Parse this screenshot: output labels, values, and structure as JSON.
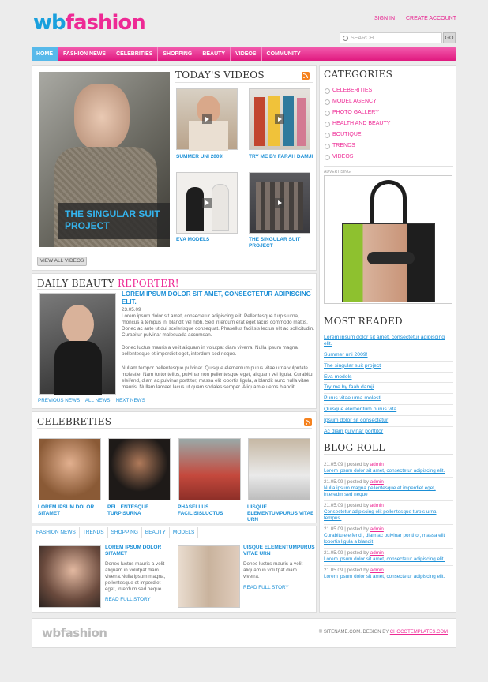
{
  "header": {
    "logo_part1": "wb",
    "logo_part2": "fashion",
    "sign_in": "SIGN IN",
    "create_account": "CREATE ACCOUNT",
    "search_placeholder": "SEARCH",
    "search_button": "GO"
  },
  "nav": [
    "HOME",
    "FASHION NEWS",
    "CELEBRITIES",
    "SHOPPING",
    "BEAUTY",
    "VIDEOS",
    "COMMUNITY"
  ],
  "feature": {
    "title": "THE SINGULAR SUIT PROJECT"
  },
  "videos": {
    "title": "TODAY'S VIDEOS",
    "items": [
      "SUMMER UNI 2009!",
      "TRY ME BY FARAH DAMJI",
      "EVA MODELS",
      "THE SINGULAR SUIT PROJECT"
    ],
    "view_all": "VIEW ALL VIDEOS"
  },
  "beauty": {
    "title_a": "DAILY BEAUTY ",
    "title_b": "REPORTER!",
    "headline": "LOREM IPSUM DOLOR SIT AMET, CONSECTETUR ADIPISCING ELIT.",
    "date": "23.05.09",
    "p1": "Lorem ipsum dolor sit amet, consectetur adipiscing elit. Pellentesque turpis urna, rhoncus a tempus in, blandit vel nibh. Sed interdum erat eget lacus commodo mattis. Donec ac ante ut dui scelerisque consequat. Phasellus facilisis lectus elit ac sollicitudin. Curabitur pulvinar malesuada accumsan.",
    "p2": "Donec luctus mauris a velit aliquam in volutpat diam viverra. Nulla ipsum magna, pellentesque et imperdiet eget, interdum sed neque.",
    "p3": "Nullam tempor pellentesque pulvinar. Quisque elementum purus vitae urna vulputate molestie. Nam tortor tellus, pulvinar non pellentesque eget, aliquam vel ligula. Curabitur eleifend, diam ac pulvinar porttitor, massa elit lobortis ligula, a blandit nunc nulla vitae mauris. Nullam laoreet lacus ut quam sodales semper. Aliquam eu eros blandit",
    "prev": "PREVIOUS NEWS",
    "all": "ALL NEWS",
    "next": "NEXT NEWS"
  },
  "celebs": {
    "title": "CELEBRETIES",
    "items": [
      "LOREM IPSUM DOLOR SITAMET",
      "PELLENTESQUE TURPISURNA",
      "PHASELLUS FACILISISLUCTUS",
      "UISQUE ELEMENTUMPURUS VITAE URN"
    ]
  },
  "tabs": [
    "FASHION NEWS",
    "TRENDS",
    "SHOPPING",
    "BEAUTY",
    "MODELS"
  ],
  "news": [
    {
      "title": "LOREM IPSUM DOLOR SITAMET",
      "body": "Donec luctus mauris a velit aliquam in volutpat diam viverra.Nulla ipsum magna, pellentesque et imperdiet eget, interdum sed neque.",
      "more": "READ FULL STORY"
    },
    {
      "title": "UISQUE ELEMENTUMPURUS VITAE URN",
      "body": "Donec luctus mauris a velit aliquam in volutpat diam viverra.",
      "more": "READ FULL STORY"
    }
  ],
  "categories": {
    "title": "CATEGORIES",
    "items": [
      "CELEBERITIES",
      "MODEL AGENCY",
      "PHOTO GALLERY",
      "HEALTH AND BEAUTY",
      "BOUTIQUE",
      "TRENDS",
      "VIDEOS"
    ]
  },
  "ad": {
    "label": "ADVERTISING"
  },
  "most": {
    "title": "MOST READED",
    "items": [
      "Lorem ipsum dolor sit amet, consectetur adipiscing elit.",
      "Summer uni 2009!",
      "The singular suit project",
      "Eva models",
      "Try me by faah damji",
      "Purus vitae urna molesti",
      "Quisque elementum purus vita",
      "Ipsum dolor sit consectetur",
      "Ac diam pulvinar porttitor"
    ]
  },
  "blog": {
    "title": "BLOG ROLL",
    "meta_prefix": "21.05.09 | posted by ",
    "author": "admin",
    "items": [
      "Lorem ipsum dolor sit amet, consectetur adipiscing elit.",
      "Nulla ipsum magna pellentesque et imperdiet eget, interedm sed neque",
      "Consectetur adipiscing elit pellentesque turpis urna tempus.",
      "Curabitu eleifend , diam ac pulvinar porttitor, massa elit lobortis ligula a blandit",
      "Lorem ipsum dolor sit amet, consectetur adipiscing elit.",
      "Lorem ipsum dolor sit amet, consectetur adipiscing elit."
    ]
  },
  "footer": {
    "logo": "wbfashion",
    "copy": "© SITENAME.COM.  DESIGN BY ",
    "designer": "CHOCOTEMPLATES.COM"
  },
  "colors": {
    "pink": "#ee2a95",
    "blue": "#1b8fd6",
    "nav_active": "#57b9ea"
  }
}
